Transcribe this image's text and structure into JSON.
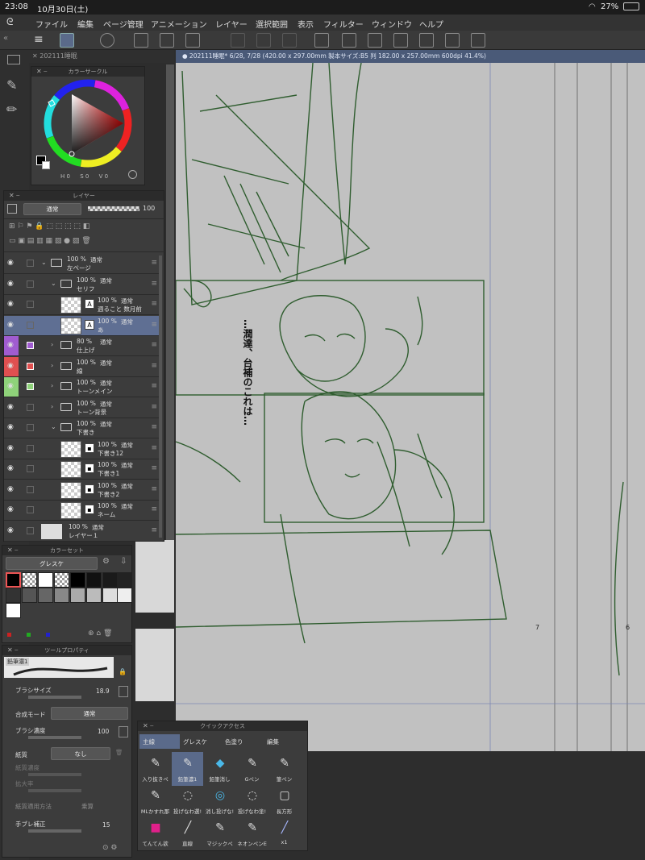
{
  "status": {
    "time": "23:08",
    "date": "10月30日(土)",
    "battery": "27%"
  },
  "menu": [
    "ファイル",
    "編集",
    "ページ管理",
    "アニメーション",
    "レイヤー",
    "選択範囲",
    "表示",
    "フィルター",
    "ウィンドウ",
    "ヘルプ"
  ],
  "doc_tab": "✕ 202111睡眠",
  "canvas_tab": "● 202111睡眠* 6/28, 7/28 (420.00 x 297.00mm 製本サイズ:B5 判 182.00 x 257.00mm 600dpi 41.4%)",
  "color_circle": {
    "title": "カラーサークル",
    "h": "0",
    "s": "0",
    "v": "0",
    "h_label": "H",
    "s_label": "S",
    "v_label": "V"
  },
  "layer_panel": {
    "title": "レイヤー",
    "blend_mode": "通常",
    "opacity": "100",
    "layers": [
      {
        "pct": "100 %",
        "mode": "通常",
        "name": "左ページ",
        "kind": "folder",
        "indent": 0,
        "open": true,
        "color": ""
      },
      {
        "pct": "100 %",
        "mode": "通常",
        "name": "セリフ",
        "kind": "folder",
        "indent": 1,
        "open": true,
        "color": ""
      },
      {
        "pct": "100 %",
        "mode": "通常",
        "name": "週ること 数月前",
        "kind": "text",
        "indent": 2,
        "color": ""
      },
      {
        "pct": "100 %",
        "mode": "通常",
        "name": "あ",
        "kind": "text",
        "indent": 2,
        "color": "",
        "selected": true
      },
      {
        "pct": "80 %",
        "mode": "通常",
        "name": "仕上げ",
        "kind": "folder",
        "indent": 1,
        "open": false,
        "color": "#a05cd0"
      },
      {
        "pct": "100 %",
        "mode": "通常",
        "name": "線",
        "kind": "folder",
        "indent": 1,
        "open": false,
        "color": "#e05050"
      },
      {
        "pct": "100 %",
        "mode": "通常",
        "name": "トーンメイン",
        "kind": "folder",
        "indent": 1,
        "open": false,
        "color": "#8fd27a"
      },
      {
        "pct": "100 %",
        "mode": "通常",
        "name": "トーン背景",
        "kind": "folder",
        "indent": 1,
        "open": false,
        "color": ""
      },
      {
        "pct": "100 %",
        "mode": "通常",
        "name": "下書き",
        "kind": "folder",
        "indent": 1,
        "open": true,
        "color": ""
      },
      {
        "pct": "100 %",
        "mode": "通常",
        "name": "下書き12",
        "kind": "raster",
        "indent": 2,
        "color": ""
      },
      {
        "pct": "100 %",
        "mode": "通常",
        "name": "下書き1",
        "kind": "raster",
        "indent": 2,
        "color": ""
      },
      {
        "pct": "100 %",
        "mode": "通常",
        "name": "下書き2",
        "kind": "raster",
        "indent": 2,
        "color": ""
      },
      {
        "pct": "100 %",
        "mode": "通常",
        "name": "ネーム",
        "kind": "raster",
        "indent": 2,
        "color": ""
      },
      {
        "pct": "100 %",
        "mode": "通常",
        "name": "レイヤー１",
        "kind": "paper",
        "indent": 0,
        "color": ""
      }
    ]
  },
  "color_set": {
    "title": "カラーセット",
    "set_name": "グレスケ"
  },
  "tool_property": {
    "title": "ツールプロパティ",
    "tool_name": "鉛筆濃1",
    "brush_size_label": "ブラシサイズ",
    "brush_size": "18.9",
    "blend_label": "合成モード",
    "blend": "通常",
    "density_label": "ブラシ濃度",
    "density": "100",
    "paper_label": "紙質",
    "paper": "なし",
    "paper_density_label": "紙質濃度",
    "magnify_label": "拡大率",
    "paper_method_label": "紙質適用方法",
    "paper_method": "乗算",
    "stabilize_label": "手ブレ補正",
    "stabilize": "15"
  },
  "quick_access": {
    "title": "クイックアクセス",
    "tabs": [
      "主線",
      "グレスケ",
      "色塗り",
      "編集"
    ],
    "items": [
      {
        "label": "入り抜きペ",
        "icon": "pen-icon"
      },
      {
        "label": "鉛筆濃1",
        "icon": "pencil-icon",
        "selected": true
      },
      {
        "label": "鉛筆消し",
        "icon": "eraser-icon"
      },
      {
        "label": "Gペン",
        "icon": "gpen-icon"
      },
      {
        "label": "筆ペン",
        "icon": "brush-pen-icon"
      },
      {
        "label": "MLかすれ那",
        "icon": "pen-icon"
      },
      {
        "label": "投げなわ選!",
        "icon": "lasso-icon"
      },
      {
        "label": "消し投げな!",
        "icon": "lasso-erase-icon"
      },
      {
        "label": "投げなわ塗!",
        "icon": "lasso-fill-icon"
      },
      {
        "label": "長方形",
        "icon": "rectangle-icon"
      },
      {
        "label": "てんてん欲",
        "icon": "dot-icon"
      },
      {
        "label": "直線",
        "icon": "line-icon"
      },
      {
        "label": "マジックペ",
        "icon": "magic-pen-icon"
      },
      {
        "label": "ネオンペンE",
        "icon": "neon-pen-icon"
      },
      {
        "label": "x1",
        "icon": "stylus-icon"
      }
    ]
  },
  "canvas": {
    "speech_col1": "…潤達、",
    "speech_col2": "台補のこれは…",
    "page_num_7": "7",
    "page_num_6": "6"
  },
  "colors": {
    "accent_selected": "#5a6a8a",
    "line_art": "#2f5d2f",
    "canvas_bg": "#c1c1c1"
  }
}
